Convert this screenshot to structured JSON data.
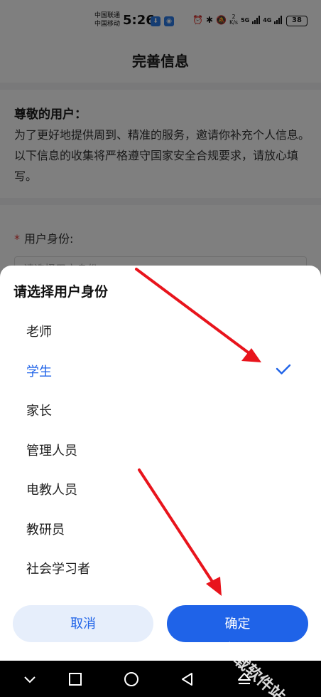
{
  "status_bar": {
    "carrier_1": "中国联通",
    "carrier_2": "中国移动",
    "time": "5:26",
    "speed_value": "2",
    "speed_unit": "K/s",
    "network_1": "5G",
    "network_2": "4G",
    "battery": "38"
  },
  "page": {
    "title": "完善信息",
    "greeting_heading": "尊敬的用户：",
    "greeting_body": "为了更好地提供周到、精准的服务，邀请你补充个人信息。以下信息的收集将严格遵守国家安全合规要求，请放心填写。",
    "required_mark": "*",
    "identity_label": "用户身份:",
    "identity_placeholder": "请选择用户身份"
  },
  "sheet": {
    "title": "请选择用户身份",
    "options": [
      {
        "label": "老师",
        "selected": false
      },
      {
        "label": "学生",
        "selected": true
      },
      {
        "label": "家长",
        "selected": false
      },
      {
        "label": "管理人员",
        "selected": false
      },
      {
        "label": "电教人员",
        "selected": false
      },
      {
        "label": "教研员",
        "selected": false
      },
      {
        "label": "社会学习者",
        "selected": false
      }
    ],
    "cancel_label": "取消",
    "confirm_label": "确定"
  },
  "colors": {
    "accent": "#1f63e8",
    "cancel_bg": "#e6eefb",
    "annotation_arrow": "#e8141c"
  },
  "icons": {
    "check": "checkmark-icon",
    "nav_back": "triangle-back-icon",
    "nav_home": "circle-home-icon",
    "nav_recent": "square-recent-icon",
    "nav_collapse": "chevron-down-icon",
    "nav_extra": "eject-icon"
  },
  "watermark": "下载软件站"
}
